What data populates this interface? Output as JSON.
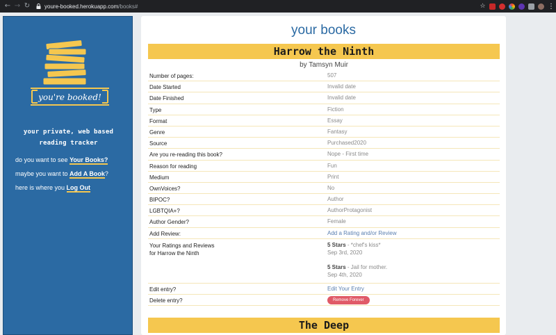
{
  "browser": {
    "url_host": "youre-booked.herokuapp.com",
    "url_path": "/books#"
  },
  "sidebar": {
    "logo_text": "you're booked!",
    "tagline": "your private, web based reading tracker",
    "links": [
      {
        "prefix": "do you want to see ",
        "link": "Your Books?",
        "suffix": ""
      },
      {
        "prefix": "maybe you want to ",
        "link": "Add A Book",
        "suffix": "?"
      },
      {
        "prefix": "here is where you ",
        "link": "Log Out",
        "suffix": ""
      }
    ]
  },
  "main": {
    "title": "your books",
    "books": [
      {
        "title": "Harrow the Ninth",
        "author": "by Tamsyn Muir",
        "fields": [
          {
            "label": "Number of pages:",
            "value": "507"
          },
          {
            "label": "Date Started",
            "value": "Invalid date"
          },
          {
            "label": "Date Finished",
            "value": "Invalid date"
          },
          {
            "label": "Type",
            "value": "Fiction"
          },
          {
            "label": "Format",
            "value": "Essay"
          },
          {
            "label": "Genre",
            "value": "Fantasy"
          },
          {
            "label": "Source",
            "value": "Purchased2020"
          },
          {
            "label": "Are you re-reading this book?",
            "value": "Nope - First time"
          },
          {
            "label": "Reason for reading",
            "value": "Fun"
          },
          {
            "label": "Medium",
            "value": "Print"
          },
          {
            "label": "OwnVoices?",
            "value": "No"
          },
          {
            "label": "BIPOC?",
            "value": "Author"
          },
          {
            "label": "LGBTQIA+?",
            "value": "AuthorProtagonist"
          },
          {
            "label": "Author Gender?",
            "value": "Female"
          },
          {
            "label": "Add Review:",
            "value": "Add a Rating and/or Review"
          }
        ],
        "reviews_label_line1": "Your Ratings and Reviews",
        "reviews_label_line2": "for Harrow the Ninth",
        "reviews": [
          {
            "stars": "5 Stars",
            "text": " - *chef's kiss*",
            "date": "Sep 3rd, 2020"
          },
          {
            "stars": "5 Stars",
            "text": " - Jail for mother.",
            "date": "Sep 4th, 2020"
          }
        ],
        "edit_label": "Edit entry?",
        "edit_link": "Edit Your Entry",
        "delete_label": "Delete entry?",
        "delete_button": "Remove Forever"
      },
      {
        "title": "The Deep"
      }
    ]
  }
}
